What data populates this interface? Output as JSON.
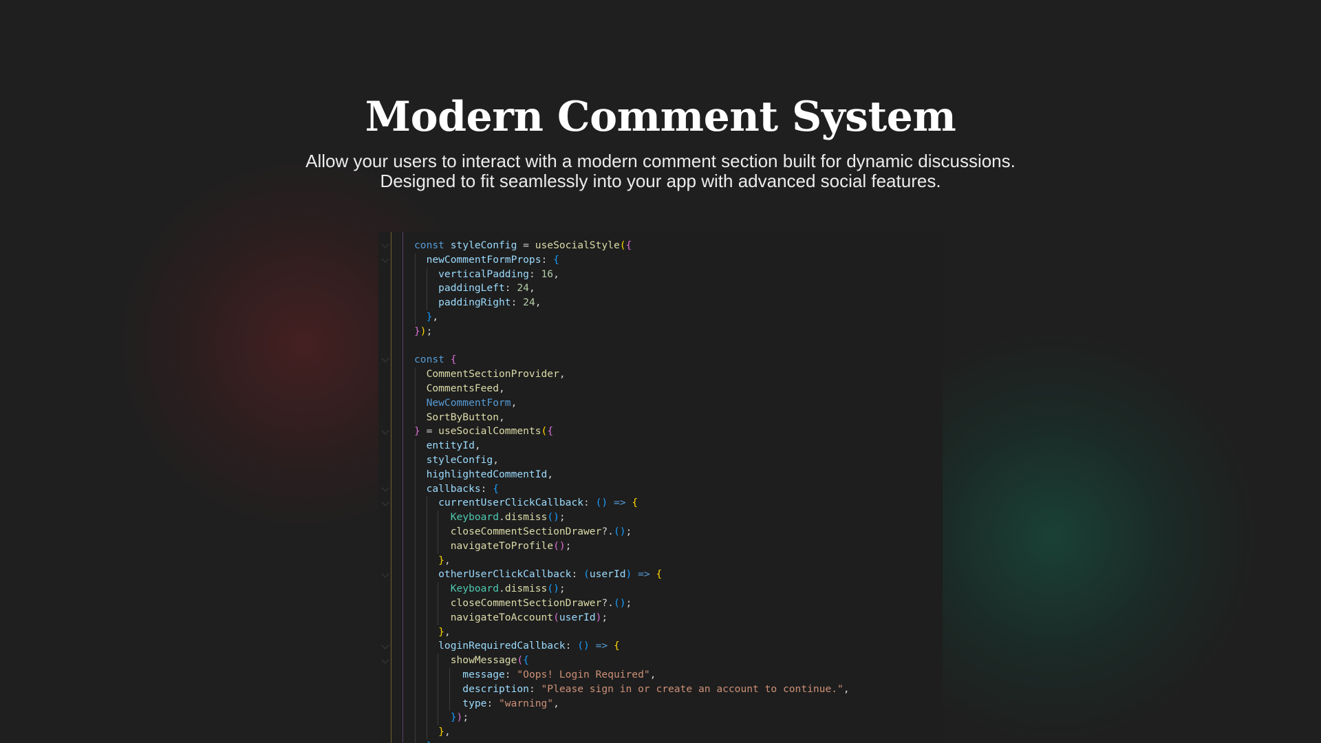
{
  "hero": {
    "title": "Modern Comment System",
    "subtitle_line1": "Allow your users to interact with a modern comment section built for dynamic discussions.",
    "subtitle_line2": "Designed to fit seamlessly into your app with advanced social features."
  },
  "code_lines": [
    [
      [
        "const ",
        "k"
      ],
      [
        "styleConfig",
        "v"
      ],
      [
        " = ",
        "p"
      ],
      [
        "useSocialStyle",
        "f"
      ],
      [
        "(",
        "b1"
      ],
      [
        "{",
        "b2"
      ]
    ],
    [
      [
        "  newCommentFormProps",
        "v"
      ],
      [
        ": ",
        "p"
      ],
      [
        "{",
        "b3"
      ]
    ],
    [
      [
        "    verticalPadding",
        "v"
      ],
      [
        ": ",
        "p"
      ],
      [
        "16",
        "n"
      ],
      [
        ",",
        "p"
      ]
    ],
    [
      [
        "    paddingLeft",
        "v"
      ],
      [
        ": ",
        "p"
      ],
      [
        "24",
        "n"
      ],
      [
        ",",
        "p"
      ]
    ],
    [
      [
        "    paddingRight",
        "v"
      ],
      [
        ": ",
        "p"
      ],
      [
        "24",
        "n"
      ],
      [
        ",",
        "p"
      ]
    ],
    [
      [
        "  }",
        "b3"
      ],
      [
        ",",
        "p"
      ]
    ],
    [
      [
        "}",
        "b2"
      ],
      [
        ")",
        "b1"
      ],
      [
        ";",
        "p"
      ]
    ],
    [],
    [
      [
        "const ",
        "k"
      ],
      [
        "{",
        "b2"
      ]
    ],
    [
      [
        "  CommentSectionProvider",
        "f"
      ],
      [
        ",",
        "p"
      ]
    ],
    [
      [
        "  CommentsFeed",
        "f"
      ],
      [
        ",",
        "p"
      ]
    ],
    [
      [
        "  NewCommentForm",
        "k"
      ],
      [
        ",",
        "p"
      ]
    ],
    [
      [
        "  SortByButton",
        "f"
      ],
      [
        ",",
        "p"
      ]
    ],
    [
      [
        "}",
        "b2"
      ],
      [
        " = ",
        "p"
      ],
      [
        "useSocialComments",
        "f"
      ],
      [
        "(",
        "b1"
      ],
      [
        "{",
        "b2"
      ]
    ],
    [
      [
        "  entityId",
        "v"
      ],
      [
        ",",
        "p"
      ]
    ],
    [
      [
        "  styleConfig",
        "v"
      ],
      [
        ",",
        "p"
      ]
    ],
    [
      [
        "  highlightedCommentId",
        "v"
      ],
      [
        ",",
        "p"
      ]
    ],
    [
      [
        "  callbacks",
        "v"
      ],
      [
        ": ",
        "p"
      ],
      [
        "{",
        "b3"
      ]
    ],
    [
      [
        "    currentUserClickCallback",
        "v"
      ],
      [
        ": ",
        "p"
      ],
      [
        "()",
        "b3"
      ],
      [
        " => ",
        "k"
      ],
      [
        "{",
        "b1"
      ]
    ],
    [
      [
        "      Keyboard",
        "c"
      ],
      [
        ".",
        "p"
      ],
      [
        "dismiss",
        "f"
      ],
      [
        "()",
        "b3"
      ],
      [
        ";",
        "p"
      ]
    ],
    [
      [
        "      closeCommentSectionDrawer",
        "f"
      ],
      [
        "?.",
        "p"
      ],
      [
        "()",
        "b3"
      ],
      [
        ";",
        "p"
      ]
    ],
    [
      [
        "      navigateToProfile",
        "f"
      ],
      [
        "()",
        "b2"
      ],
      [
        ";",
        "p"
      ]
    ],
    [
      [
        "    }",
        "b1"
      ],
      [
        ",",
        "p"
      ]
    ],
    [
      [
        "    otherUserClickCallback",
        "v"
      ],
      [
        ": ",
        "p"
      ],
      [
        "(",
        "b3"
      ],
      [
        "userId",
        "v"
      ],
      [
        ")",
        "b3"
      ],
      [
        " => ",
        "k"
      ],
      [
        "{",
        "b1"
      ]
    ],
    [
      [
        "      Keyboard",
        "c"
      ],
      [
        ".",
        "p"
      ],
      [
        "dismiss",
        "f"
      ],
      [
        "()",
        "b3"
      ],
      [
        ";",
        "p"
      ]
    ],
    [
      [
        "      closeCommentSectionDrawer",
        "f"
      ],
      [
        "?.",
        "p"
      ],
      [
        "()",
        "b3"
      ],
      [
        ";",
        "p"
      ]
    ],
    [
      [
        "      navigateToAccount",
        "f"
      ],
      [
        "(",
        "b2"
      ],
      [
        "userId",
        "v"
      ],
      [
        ")",
        "b2"
      ],
      [
        ";",
        "p"
      ]
    ],
    [
      [
        "    }",
        "b1"
      ],
      [
        ",",
        "p"
      ]
    ],
    [
      [
        "    loginRequiredCallback",
        "v"
      ],
      [
        ": ",
        "p"
      ],
      [
        "()",
        "b3"
      ],
      [
        " => ",
        "k"
      ],
      [
        "{",
        "b1"
      ]
    ],
    [
      [
        "      showMessage",
        "f"
      ],
      [
        "(",
        "b2"
      ],
      [
        "{",
        "b3"
      ]
    ],
    [
      [
        "        message",
        "v"
      ],
      [
        ": ",
        "p"
      ],
      [
        "\"Oops! Login Required\"",
        "s"
      ],
      [
        ",",
        "p"
      ]
    ],
    [
      [
        "        description",
        "v"
      ],
      [
        ": ",
        "p"
      ],
      [
        "\"Please sign in or create an account to continue.\"",
        "s"
      ],
      [
        ",",
        "p"
      ]
    ],
    [
      [
        "        type",
        "v"
      ],
      [
        ": ",
        "p"
      ],
      [
        "\"warning\"",
        "s"
      ],
      [
        ",",
        "p"
      ]
    ],
    [
      [
        "      }",
        "b3"
      ],
      [
        ")",
        "b2"
      ],
      [
        ";",
        "p"
      ]
    ],
    [
      [
        "    }",
        "b1"
      ],
      [
        ",",
        "p"
      ]
    ],
    [
      [
        "  }",
        "b3"
      ]
    ]
  ]
}
